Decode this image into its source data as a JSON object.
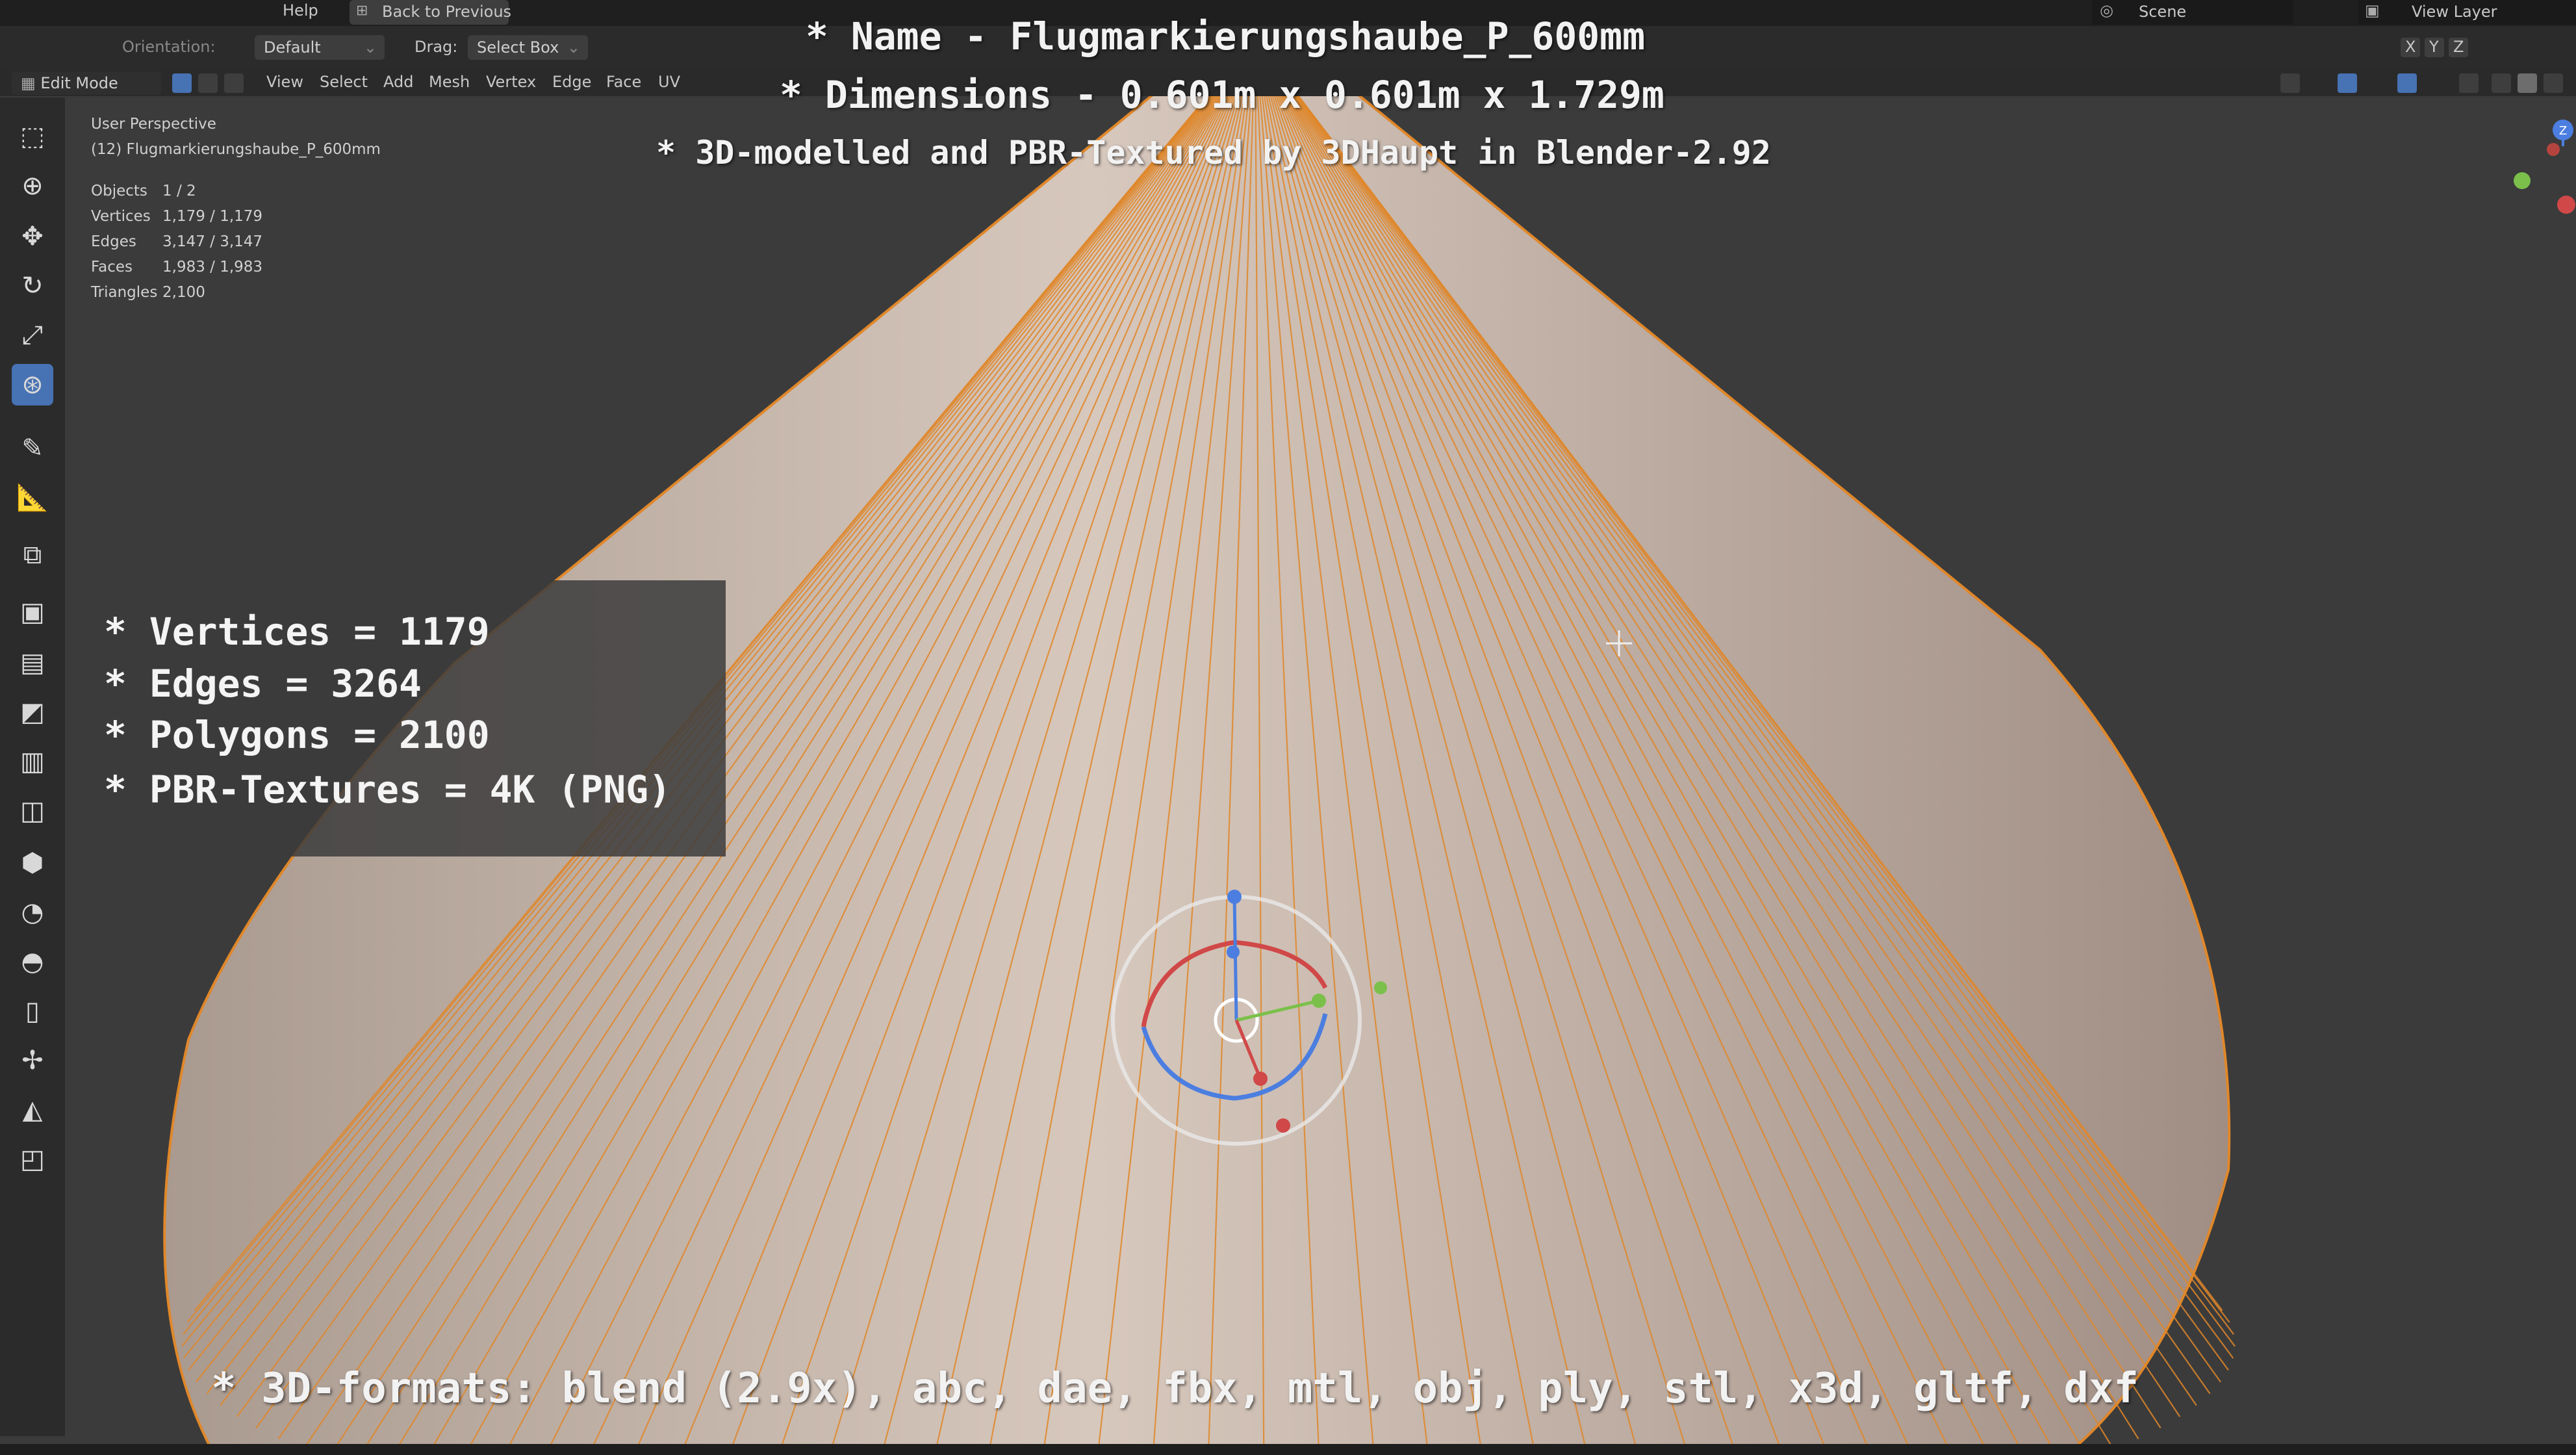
{
  "top_bar": {
    "menu_help": "Help",
    "back_button": "Back to Previous",
    "scene_label": "Scene",
    "view_layer_label": "View Layer"
  },
  "header": {
    "orientation_label": "Orientation:",
    "orientation_value": "Default",
    "drag_label": "Drag:",
    "drag_value": "Select Box"
  },
  "edit_row": {
    "mode": "Edit Mode",
    "menus": [
      "View",
      "Select",
      "Add",
      "Mesh",
      "Vertex",
      "Edge",
      "Face",
      "UV"
    ]
  },
  "viewport_info": {
    "perspective": "User Perspective",
    "object_name": "(12) Flugmarkierungshaube_P_600mm"
  },
  "stats": [
    {
      "label": "Objects",
      "value": "1 / 2"
    },
    {
      "label": "Vertices",
      "value": "1,179 / 1,179"
    },
    {
      "label": "Edges",
      "value": "3,147 / 3,147"
    },
    {
      "label": "Faces",
      "value": "1,983 / 1,983"
    },
    {
      "label": "Triangles",
      "value": "2,100"
    }
  ],
  "overlay": {
    "name_line": "* Name - Flugmarkierungshaube_P_600mm",
    "dimensions_line": "* Dimensions -  0.601m x 0.601m x 1.729m",
    "credit_line": "* 3D-modelled and PBR-Textured by 3DHaupt in Blender-2.92",
    "formats_line": "* 3D-formats: blend (2.9x), abc, dae, fbx, mtl, obj, ply, stl, x3d, gltf, dxf"
  },
  "info_box": {
    "vertices": "* Vertices = 1179",
    "edges": "* Edges = 3264",
    "polygons": "* Polygons = 2100",
    "textures": "* PBR-Textures = 4K (PNG)"
  },
  "axis_labels": {
    "x": "X",
    "y": "Y",
    "z": "Z"
  },
  "colors": {
    "mesh_edge": "#e0872a",
    "cone_fill": "#c9b9ad",
    "active_tool": "#4772b3",
    "background": "#3b3b3b"
  }
}
